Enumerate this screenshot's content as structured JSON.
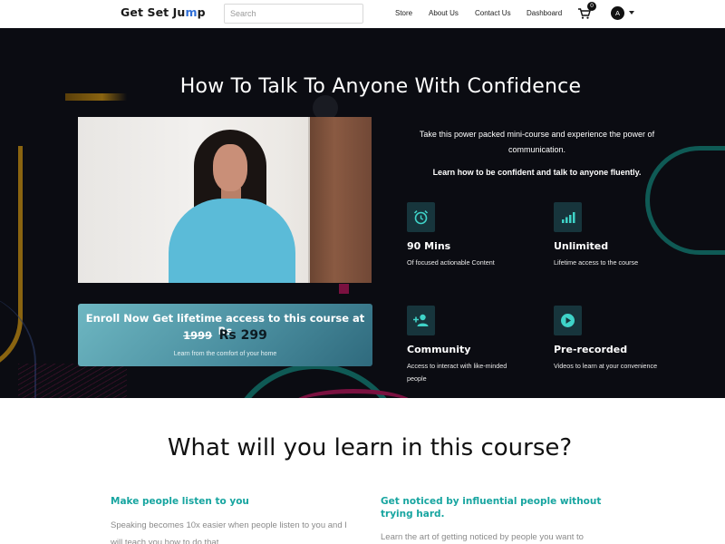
{
  "nav": {
    "logo_text_start": "Get Set Ju",
    "logo_text_accent": "m",
    "logo_text_end": "p",
    "search_placeholder": "Search",
    "links": [
      "Store",
      "About Us",
      "Contact Us",
      "Dashboard"
    ],
    "cart_count": "0",
    "avatar_letter": "A",
    "icons": {
      "cart": "shopping-cart-icon",
      "dropdown": "chevron-down-icon"
    }
  },
  "hero": {
    "title": "How To Talk To Anyone With Confidence",
    "intro": "Take this power packed mini-course and experience the power of communication.",
    "intro_bold": "Learn how to be confident and talk to anyone fluently.",
    "enroll": {
      "headline": "Enroll Now Get lifetime access to this course at Rs",
      "old_price": "1999",
      "new_price": "Rs 299",
      "subtext": "Learn from the comfort of your home"
    },
    "features": [
      {
        "icon": "alarm-clock-icon",
        "title": "90 Mins",
        "desc": "Of focused actionable Content"
      },
      {
        "icon": "signal-bars-icon",
        "title": "Unlimited",
        "desc": "Lifetime access to the course"
      },
      {
        "icon": "add-person-icon",
        "title": "Community",
        "desc": "Access to interact with like-minded people"
      },
      {
        "icon": "play-circle-icon",
        "title": "Pre-recorded",
        "desc": "Videos to learn at your convenience"
      }
    ]
  },
  "learn": {
    "title": "What will you learn in this course?",
    "items": [
      {
        "title": "Make people listen to you",
        "desc": "Speaking becomes 10x easier when people listen to you and I will teach you how to do that"
      },
      {
        "title": "Get noticed by influential people without trying hard.",
        "desc": "Learn the art of getting noticed by people you want to"
      }
    ]
  },
  "colors": {
    "hero_bg": "#0b0c12",
    "accent_teal": "#17a5a0",
    "logo_accent": "#2f6fd8",
    "icon_tile": "#17353c"
  }
}
